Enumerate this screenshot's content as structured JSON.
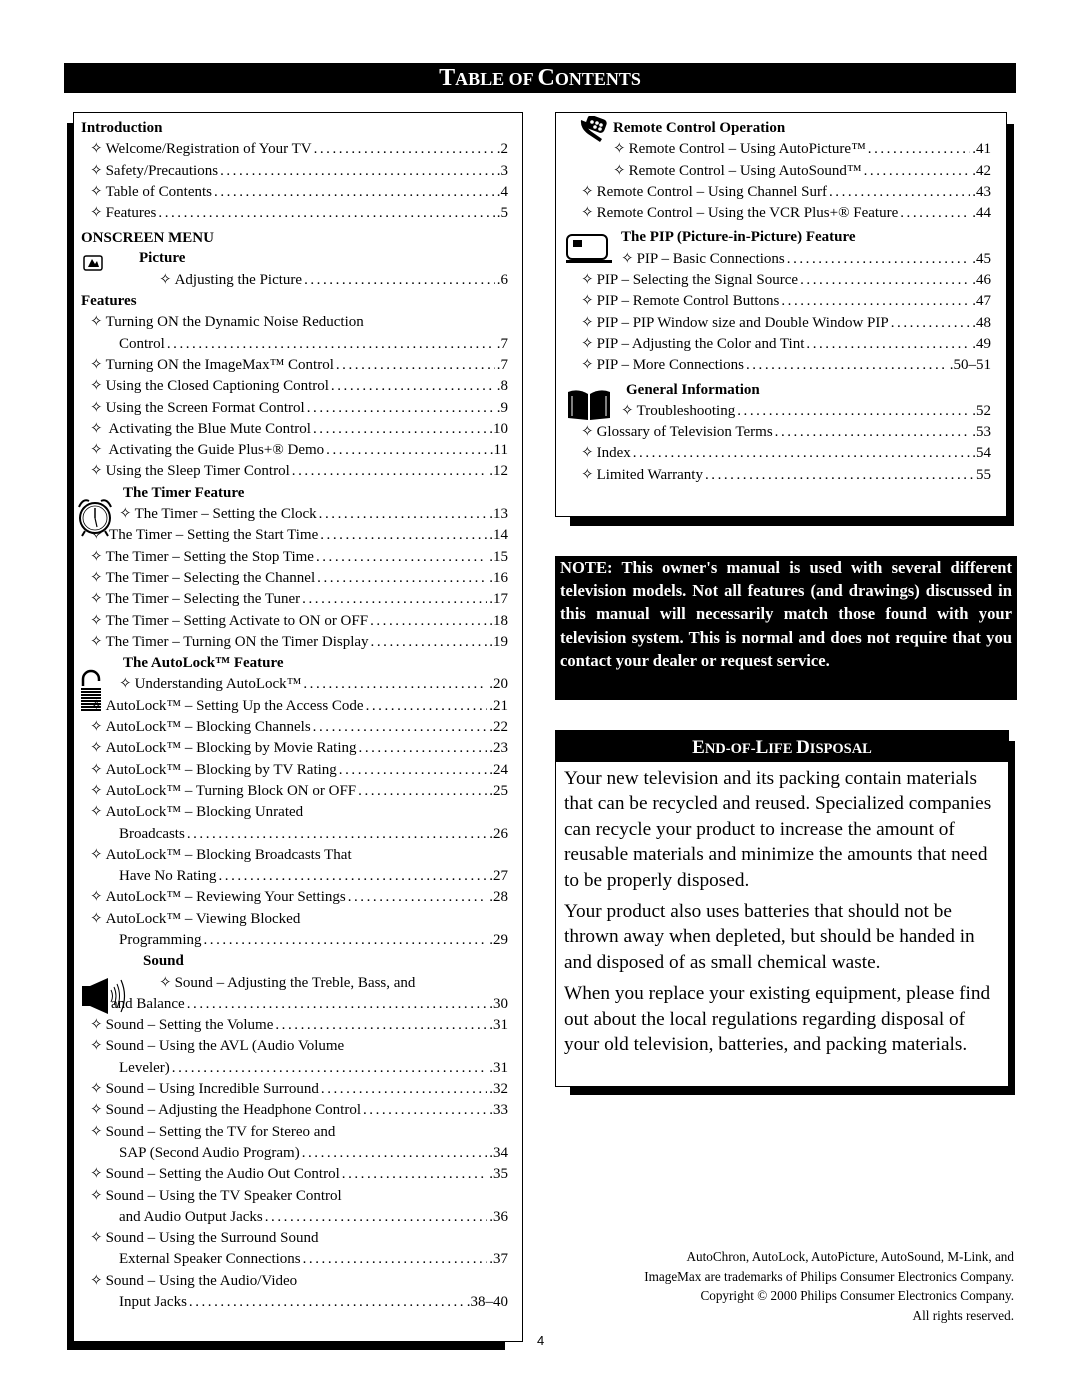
{
  "title": {
    "first_cap": "T",
    "first_rest": "ABLE OF ",
    "second_cap": "C",
    "second_rest": "ONTENTS"
  },
  "bullet": "✧",
  "left": {
    "introduction": {
      "heading": "Introduction",
      "items": [
        {
          "label": "Welcome/Registration of Your TV",
          "page": ".2"
        },
        {
          "label": "Safety/Precautions",
          "page": ".3"
        },
        {
          "label": "Table of Contents",
          "page": ".4"
        },
        {
          "label": "Features",
          "page": ".5"
        }
      ]
    },
    "onscreen_menu": {
      "heading": "ONSCREEN MENU"
    },
    "picture": {
      "heading": "Picture",
      "items": [
        {
          "label": "Adjusting the Picture",
          "page": ".6"
        }
      ]
    },
    "features": {
      "heading": "Features",
      "items": [
        {
          "label": "Turning ON the Dynamic Noise Reduction",
          "cont": "Control",
          "page": ".7"
        },
        {
          "label": "Turning ON the ImageMax™ Control",
          "page": ".7"
        },
        {
          "label": "Using the Closed Captioning Control",
          "page": ".8"
        },
        {
          "label": "Using the Screen Format Control",
          "page": ".9"
        },
        {
          "label": " Activating the Blue Mute Control",
          "page": ".10"
        },
        {
          "label": " Activating the Guide Plus+® Demo",
          "page": ".11"
        },
        {
          "label": "Using the Sleep Timer Control",
          "page": ".12"
        }
      ]
    },
    "timer": {
      "heading": "The Timer Feature",
      "items": [
        {
          "label": "The Timer – Setting the Clock",
          "page": ".13"
        },
        {
          "label": " The Timer – Setting the Start Time",
          "page": ".14"
        },
        {
          "label": "The Timer – Setting the Stop Time",
          "page": ".15"
        },
        {
          "label": "The Timer – Selecting the Channel",
          "page": ".16"
        },
        {
          "label": "The Timer – Selecting the Tuner",
          "page": ".17"
        },
        {
          "label": "The Timer – Setting Activate to ON or OFF",
          "page": ".18"
        },
        {
          "label": "The Timer – Turning ON the Timer Display",
          "page": ".19"
        }
      ]
    },
    "autolock": {
      "heading": "The AutoLock™ Feature",
      "items": [
        {
          "label": "Understanding AutoLock™",
          "page": ".20"
        },
        {
          "label": "AutoLock™ – Setting Up the Access Code",
          "page": ".21"
        },
        {
          "label": "AutoLock™ – Blocking Channels",
          "page": ".22"
        },
        {
          "label": "AutoLock™ – Blocking by Movie Rating",
          "page": ".23"
        },
        {
          "label": "AutoLock™ – Blocking by TV Rating",
          "page": ".24"
        },
        {
          "label": "AutoLock™ – Turning Block ON or OFF",
          "page": ".25"
        },
        {
          "label": "AutoLock™ – Blocking Unrated",
          "cont": "Broadcasts",
          "page": ".26"
        },
        {
          "label": "AutoLock™ – Blocking Broadcasts That",
          "cont": "Have No Rating",
          "page": ".27"
        },
        {
          "label": "AutoLock™ – Reviewing Your Settings",
          "page": ".28"
        },
        {
          "label": "AutoLock™ – Viewing Blocked",
          "cont": "Programming",
          "page": ".29"
        }
      ]
    },
    "sound": {
      "heading": "Sound",
      "items": [
        {
          "label": "Sound – Adjusting the Treble, Bass, and",
          "cont": "and Balance",
          "page": ".30"
        },
        {
          "label": "Sound – Setting the Volume",
          "page": ".31"
        },
        {
          "label": "Sound – Using the AVL (Audio Volume",
          "cont": "Leveler)",
          "page": ".31"
        },
        {
          "label": "Sound – Using Incredible Surround",
          "page": ".32"
        },
        {
          "label": "Sound – Adjusting the Headphone Control",
          "page": ".33"
        },
        {
          "label": "Sound – Setting the TV for Stereo and",
          "cont": "SAP (Second Audio Program)",
          "page": ".34"
        },
        {
          "label": "Sound – Setting the Audio Out Control",
          "page": ".35"
        },
        {
          "label": "Sound – Using the TV Speaker Control",
          "cont": "and Audio Output Jacks",
          "page": ".36"
        },
        {
          "label": "Sound – Using the Surround Sound",
          "cont": "External Speaker Connections",
          "page": ".37"
        },
        {
          "label": "Sound – Using the Audio/Video",
          "cont": "Input Jacks",
          "page": ".38–40"
        }
      ]
    }
  },
  "right": {
    "remote": {
      "heading": "Remote Control Operation",
      "items": [
        {
          "label": "Remote Control – Using AutoPicture™",
          "page": ".41"
        },
        {
          "label": "Remote Control – Using AutoSound™",
          "page": ".42"
        },
        {
          "label": "Remote Control – Using Channel Surf",
          "page": ".43"
        },
        {
          "label": "Remote Control – Using the VCR Plus+® Feature",
          "page": ".44"
        }
      ]
    },
    "pip": {
      "heading": "The PIP (Picture-in-Picture) Feature",
      "items": [
        {
          "label": "PIP – Basic Connections",
          "page": ".45"
        },
        {
          "label": "PIP – Selecting the Signal Source",
          "page": ".46"
        },
        {
          "label": "PIP – Remote Control Buttons",
          "page": ".47"
        },
        {
          "label": "PIP – PIP Window size and Double Window PIP",
          "page": ".48"
        },
        {
          "label": "PIP – Adjusting the Color and Tint",
          "page": ".49"
        },
        {
          "label": "PIP – More Connections",
          "page": ".50–51"
        }
      ]
    },
    "general": {
      "heading": "General Information",
      "items": [
        {
          "label": "Troubleshooting",
          "page": ".52"
        },
        {
          "label": "Glossary of Television Terms",
          "page": ".53"
        },
        {
          "label": "Index",
          "page": ".54"
        },
        {
          "label": "Limited Warranty",
          "page": "55"
        }
      ]
    }
  },
  "note": "NOTE: This owner's manual is used with several different television models.  Not all features (and  drawings) discussed in this manual will necessarily match those found with your television system. This is normal and does not require that you contact your dealer or request service.",
  "disposal": {
    "title": {
      "c1": "E",
      "r1": "ND-OF-",
      "c2": "L",
      "r2": "IFE ",
      "c3": "D",
      "r3": "ISPOSAL"
    },
    "paragraphs": [
      "Your new television and its packing contain materials that can be recycled and reused. Specialized companies can recycle your product to increase the amount of reusable materials and minimize the amounts that need to be properly disposed.",
      "Your product also uses batteries that should not be thrown away when depleted, but should be handed in and disposed of as small chemical waste.",
      "When you replace your existing equipment, please find out about the local regulations regarding disposal of your old television, batteries, and packing materials."
    ]
  },
  "legal": {
    "line1": "AutoChron, AutoLock, AutoPicture, AutoSound, M-Link, and",
    "line2": "ImageMax are trademarks of Philips Consumer Electronics Company.",
    "line3": "Copyright © 2000 Philips Consumer Electronics Company.",
    "line4": "All rights reserved."
  },
  "page_number": "4"
}
